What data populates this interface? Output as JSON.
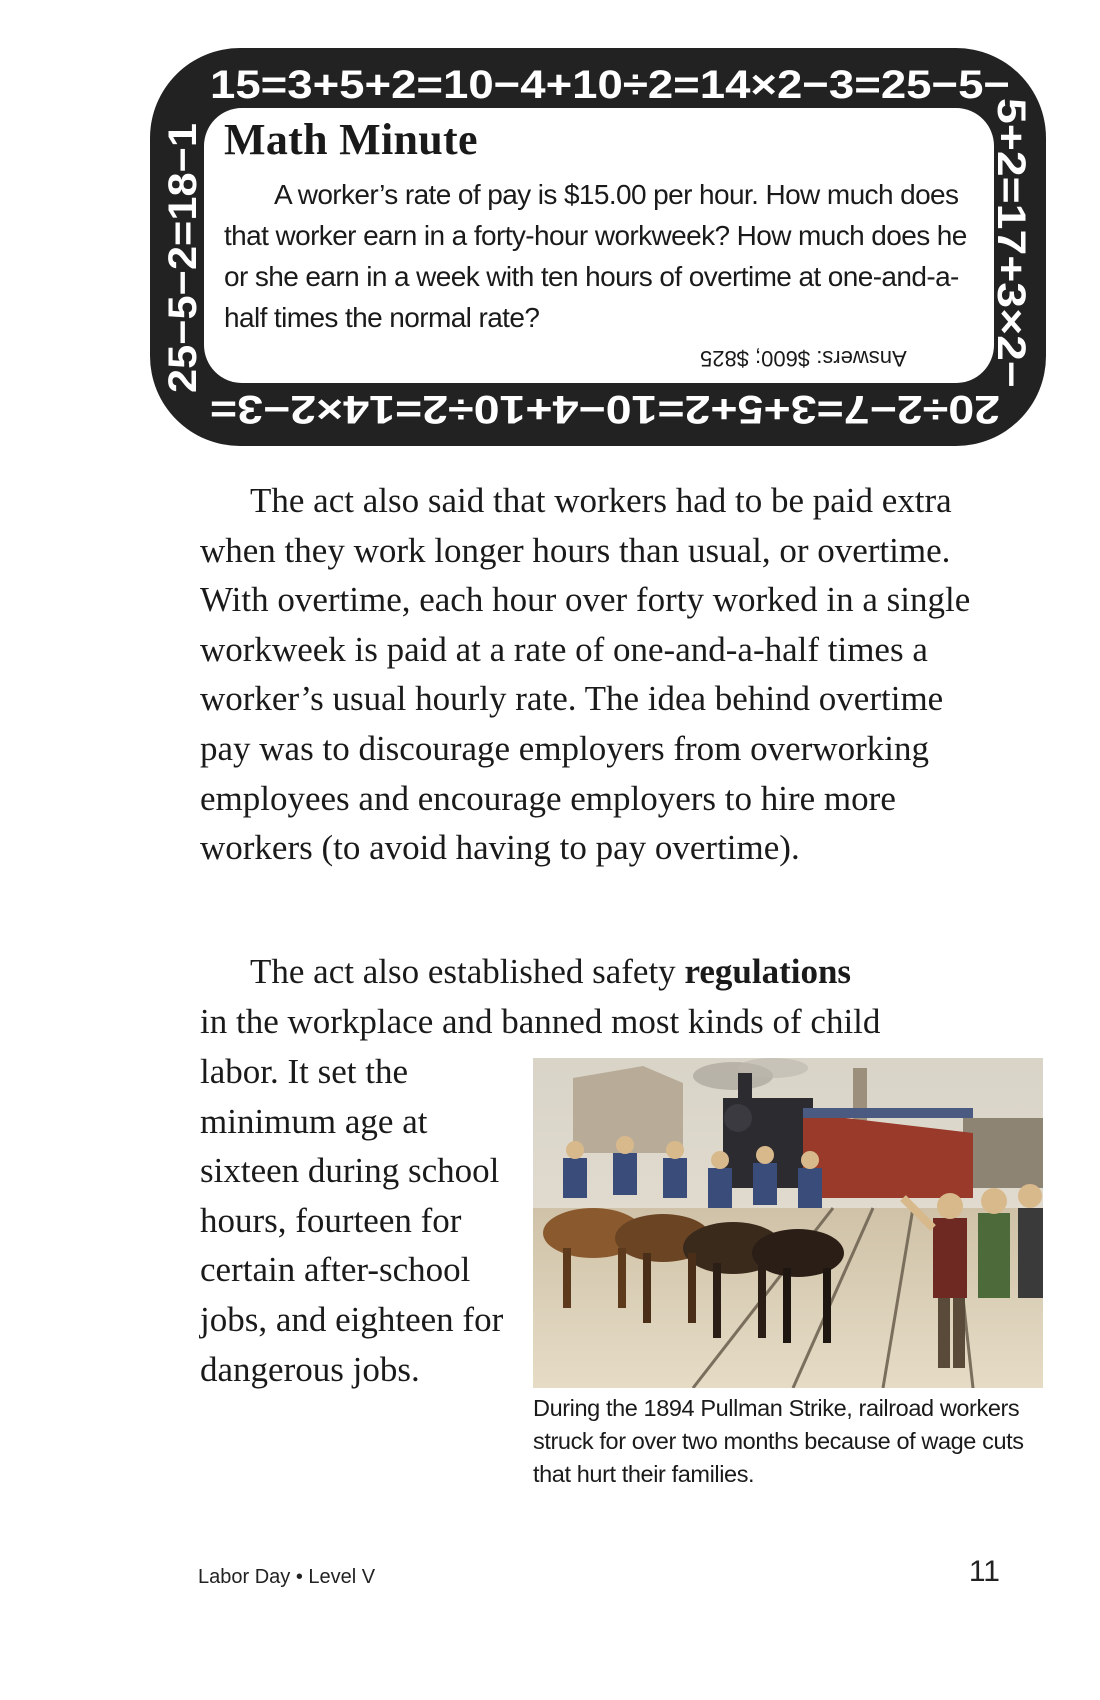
{
  "math_minute": {
    "title": "Math Minute",
    "question": "A worker’s rate of pay is $15.00 per hour. How much does that worker earn in a forty-hour workweek? How much does he or she earn in a week with ten hours of overtime at one-and-a-half times the normal rate?",
    "answer": "Answers: $600; $825",
    "border_top": "15=3+5+2=10−4+10÷2=14×2−3=25−5−",
    "border_right": "5+2=17+3×2−",
    "border_bottom": "20÷2−7=3+5+2=10−4+10÷2=14×2−3=",
    "border_left": "25−5−2=18−1",
    "frame_color": "#222222"
  },
  "body": {
    "paragraph_1": "The act also said that workers had to be paid extra when they work longer hours than usual, or overtime. With overtime, each hour over forty worked in a single workweek is paid at a rate of one-and-a-half times a worker’s usual hourly rate. The idea behind overtime pay was to discourage employers from overworking employees and encourage employers to hire more workers (to avoid having to pay overtime).",
    "paragraph_2_start": "The act also established safety",
    "paragraph_2_bold": "regulations",
    "paragraph_2_rest": "in the workplace and banned most kinds of child",
    "paragraph_2_wrap": "labor. It set the minimum age at sixteen during school hours, fourteen for certain after-school jobs, and eighteen for dangerous jobs."
  },
  "figure": {
    "caption": "During the 1894 Pullman Strike, railroad workers struck for over two months because of wage cuts that hurt their families."
  },
  "footer": {
    "book": "Labor Day • Level V",
    "page_number": "11"
  }
}
